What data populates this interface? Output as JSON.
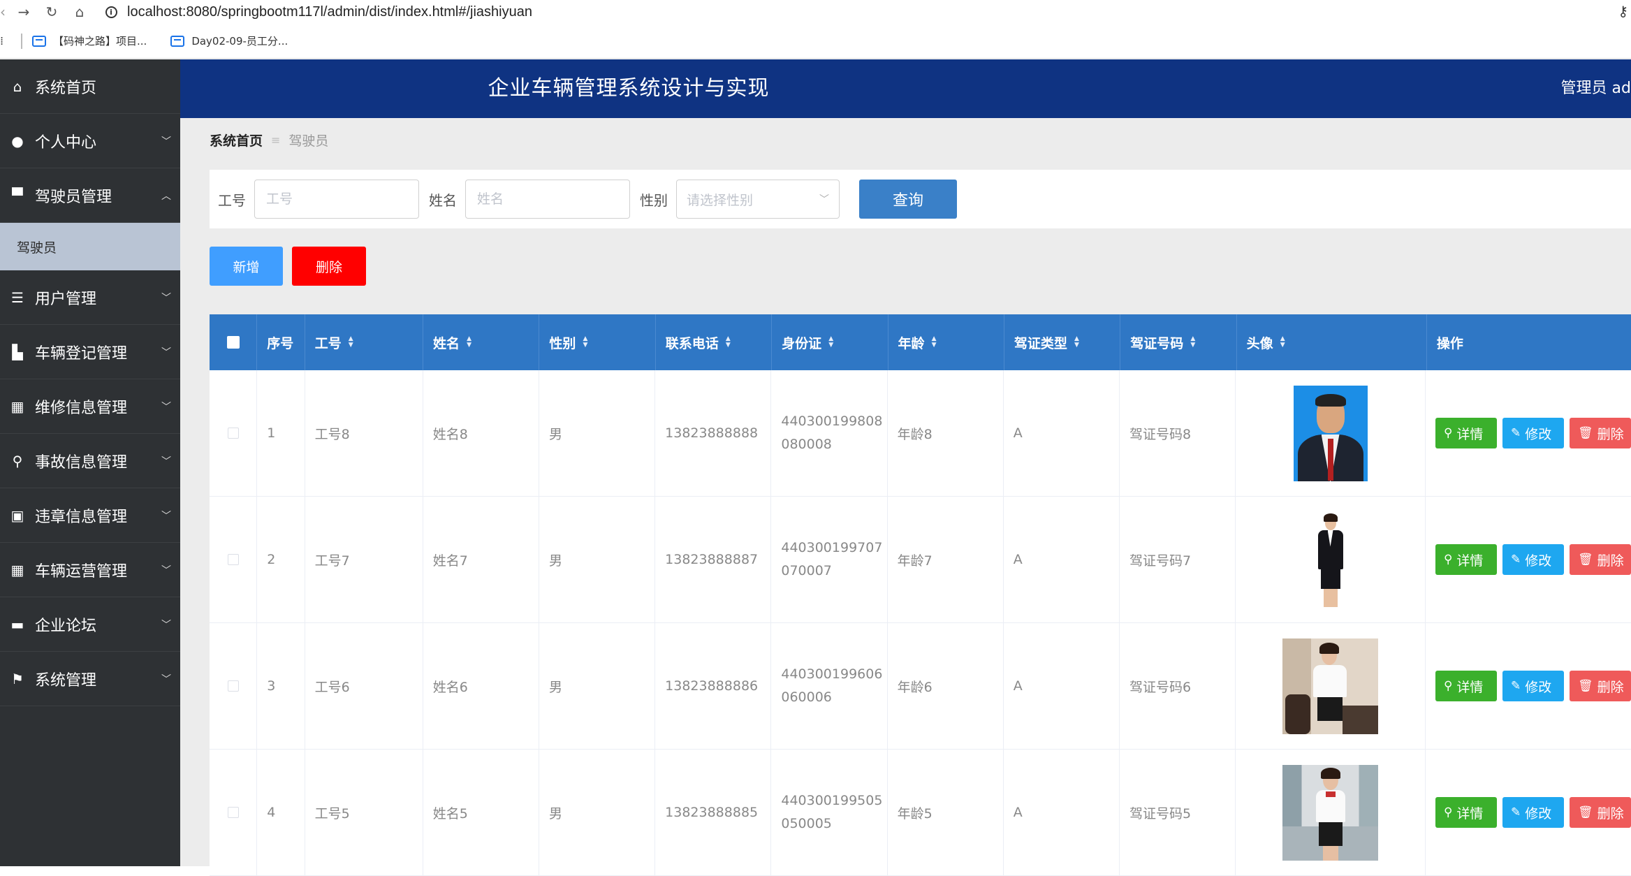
{
  "browser": {
    "url": "localhost:8080/springbootm117l/admin/dist/index.html#/jiashiyuan",
    "bookmarks": [
      "【码神之路】项目...",
      "Day02-09-员工分..."
    ]
  },
  "sidebar": {
    "items": [
      {
        "label": "系统首页",
        "icon": "home-icon",
        "chevron": false
      },
      {
        "label": "个人中心",
        "icon": "user-icon",
        "chevron": true
      },
      {
        "label": "驾驶员管理",
        "icon": "flag-board-icon",
        "chevron": true,
        "expanded": true
      },
      {
        "label": "用户管理",
        "icon": "sliders-icon",
        "chevron": true
      },
      {
        "label": "车辆登记管理",
        "icon": "car-icon",
        "chevron": true
      },
      {
        "label": "维修信息管理",
        "icon": "grid-icon",
        "chevron": true
      },
      {
        "label": "事故信息管理",
        "icon": "person-icon",
        "chevron": true
      },
      {
        "label": "违章信息管理",
        "icon": "briefcase-icon",
        "chevron": true
      },
      {
        "label": "车辆运营管理",
        "icon": "grid-icon",
        "chevron": true
      },
      {
        "label": "企业论坛",
        "icon": "ticket-icon",
        "chevron": true
      },
      {
        "label": "系统管理",
        "icon": "flag-icon",
        "chevron": true
      }
    ],
    "submenu_active": "驾驶员"
  },
  "header": {
    "title": "企业车辆管理系统设计与实现",
    "user": "管理员 ad"
  },
  "breadcrumb": {
    "home": "系统首页",
    "sep": "≡",
    "current": "驾驶员"
  },
  "search": {
    "gonghao_label": "工号",
    "gonghao_placeholder": "工号",
    "xingming_label": "姓名",
    "xingming_placeholder": "姓名",
    "xingbie_label": "性别",
    "xingbie_placeholder": "请选择性别",
    "query_button": "查询"
  },
  "actions": {
    "add": "新增",
    "delete": "删除"
  },
  "table": {
    "columns": [
      "序号",
      "工号",
      "姓名",
      "性别",
      "联系电话",
      "身份证",
      "年龄",
      "驾证类型",
      "驾证号码",
      "头像",
      "操作"
    ],
    "rows": [
      {
        "index": "1",
        "gonghao": "工号8",
        "xingming": "姓名8",
        "xingbie": "男",
        "phone": "13823888888",
        "id_line1": "440300199808",
        "id_line2": "080008",
        "age": "年龄8",
        "license_type": "A",
        "license_no": "驾证号码8",
        "avatar": "man-in-suit-photo"
      },
      {
        "index": "2",
        "gonghao": "工号7",
        "xingming": "姓名7",
        "xingbie": "男",
        "phone": "13823888887",
        "id_line1": "440300199707",
        "id_line2": "070007",
        "age": "年龄7",
        "license_type": "A",
        "license_no": "驾证号码7",
        "avatar": "woman-in-suit-photo"
      },
      {
        "index": "3",
        "gonghao": "工号6",
        "xingming": "姓名6",
        "xingbie": "男",
        "phone": "13823888886",
        "id_line1": "440300199606",
        "id_line2": "060006",
        "age": "年龄6",
        "license_type": "A",
        "license_no": "驾证号码6",
        "avatar": "woman-in-office-photo"
      },
      {
        "index": "4",
        "gonghao": "工号5",
        "xingming": "姓名5",
        "xingbie": "男",
        "phone": "13823888885",
        "id_line1": "440300199505",
        "id_line2": "050005",
        "age": "年龄5",
        "license_type": "A",
        "license_no": "驾证号码5",
        "avatar": "woman-in-uniform-photo"
      }
    ],
    "ops": {
      "detail": "详情",
      "edit": "修改",
      "remove": "删除"
    }
  },
  "colors": {
    "sidebar_bg": "#2e3134",
    "header_bg": "#0f3382",
    "table_header_bg": "#2f77c5",
    "add_button": "#409eff",
    "delete_button": "#ff0000",
    "detail_button": "#3bb02c",
    "edit_button": "#1ea7f0",
    "remove_button": "#ef5a5a"
  }
}
